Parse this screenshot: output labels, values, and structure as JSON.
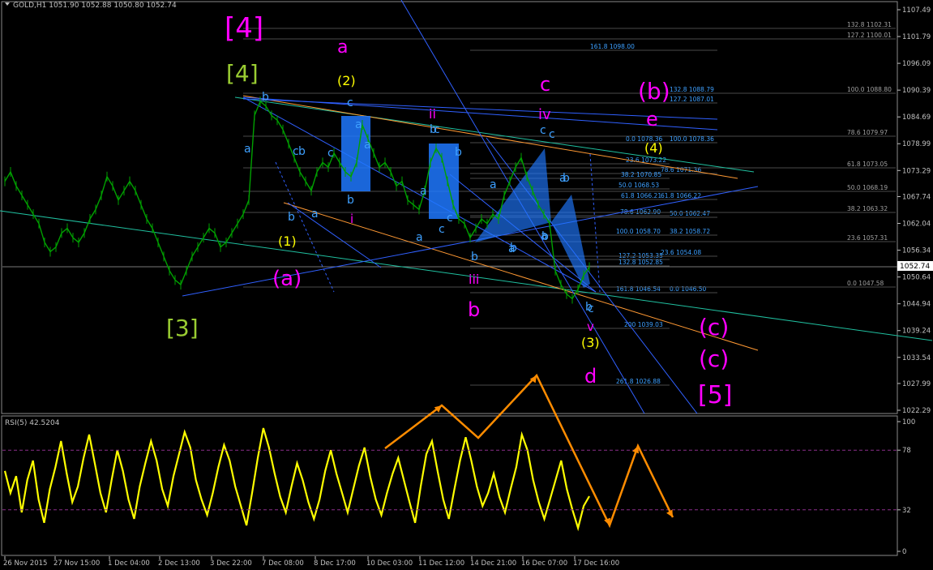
{
  "header": {
    "title": "GOLD,H1  1051.90 1052.88 1050.80 1052.74"
  },
  "rsi_header": {
    "title": "RSI(5) 42.5204"
  },
  "colors": {
    "background": "#000000",
    "candle": "#00a000",
    "rsi": "#ffff00",
    "magenta": "#ff00ff",
    "olive": "#9acd32",
    "blue_label": "#3ea0ff",
    "yellow_label": "#ffff00",
    "orange": "#ff8c00",
    "pattern_fill": "#1e78ff"
  },
  "chart_data": [
    {
      "type": "line",
      "title": "GOLD,H1  1051.90 1052.88 1050.80 1052.74",
      "symbol": "GOLD",
      "timeframe": "H1",
      "ohlc_last": {
        "open": 1051.9,
        "high": 1052.88,
        "low": 1050.8,
        "close": 1052.74
      },
      "ylim": [
        1022.29,
        1107.49
      ],
      "y_ticks": [
        "1107.49",
        "1101.79",
        "1096.09",
        "1090.39",
        "1084.69",
        "1078.99",
        "1073.29",
        "1067.74",
        "1062.04",
        "1056.34",
        "1050.64",
        "1044.94",
        "1039.24",
        "1033.54",
        "1027.99",
        "1022.29"
      ],
      "current_price_label": "1052.74",
      "x_ticks": [
        "26 Nov 2015",
        "27 Nov 15:00",
        "1 Dec 04:00",
        "2 Dec 13:00",
        "3 Dec 22:00",
        "7 Dec 08:00",
        "8 Dec 17:00",
        "10 Dec 03:00",
        "11 Dec 12:00",
        "14 Dec 21:00",
        "16 Dec 07:00",
        "17 Dec 16:00"
      ],
      "series": [
        {
          "values": [
            1071,
            1073,
            1070,
            1068,
            1066,
            1064,
            1062,
            1058,
            1056,
            1057,
            1060,
            1061,
            1059,
            1058,
            1060,
            1063,
            1065,
            1068,
            1072,
            1070,
            1067,
            1069,
            1071,
            1069,
            1066,
            1063,
            1061,
            1058,
            1055,
            1052,
            1050,
            1049,
            1052,
            1055,
            1057,
            1059,
            1061,
            1060,
            1057,
            1058,
            1060,
            1062,
            1064,
            1067,
            1085,
            1088,
            1087,
            1085,
            1084,
            1082,
            1079,
            1076,
            1073,
            1071,
            1069,
            1073,
            1075,
            1074,
            1077,
            1075,
            1073,
            1072,
            1075,
            1083,
            1080,
            1077,
            1074,
            1075,
            1073,
            1070,
            1071,
            1067,
            1066,
            1065,
            1069,
            1075,
            1078,
            1076,
            1071,
            1066,
            1063,
            1062,
            1059,
            1061,
            1063,
            1062,
            1064,
            1063,
            1068,
            1071,
            1074,
            1076,
            1072,
            1069,
            1066,
            1064,
            1062,
            1052,
            1049,
            1047,
            1046,
            1048,
            1051,
            1052.74
          ]
        }
      ],
      "fibonacci_levels": [
        {
          "label": "161.8 1098.00"
        },
        {
          "label": "132.8 1102.31"
        },
        {
          "label": "127.2 1100.01"
        },
        {
          "label": "132.8 1088.79"
        },
        {
          "label": "127.2 1087.01"
        },
        {
          "label": "100.0 1088.80"
        },
        {
          "label": "78.6 1079.97"
        },
        {
          "label": "100.0 1078.36"
        },
        {
          "label": "0.0 1078.36"
        },
        {
          "label": "23.6 1073.22"
        },
        {
          "label": "78.6 1071.36"
        },
        {
          "label": "61.8 1073.05"
        },
        {
          "label": "38.2 1070.85"
        },
        {
          "label": "50.0 1068.53"
        },
        {
          "label": "50.0 1068.19"
        },
        {
          "label": "61.8 1066.21"
        },
        {
          "label": "61.8 1066.22"
        },
        {
          "label": "78.6 1062.90"
        },
        {
          "label": "50.0 1062.47"
        },
        {
          "label": "38.2 1063.32"
        },
        {
          "label": "100.0 1058.70"
        },
        {
          "label": "38.2 1058.72"
        },
        {
          "label": "23.6 1057.31"
        },
        {
          "label": "127.2 1053.35"
        },
        {
          "label": "132.8 1052.85"
        },
        {
          "label": "23.6 1054.08"
        },
        {
          "label": "161.8 1046.54"
        },
        {
          "label": "0.0 1046.50"
        },
        {
          "label": "0.0 1047.58"
        },
        {
          "label": "200 1039.03"
        },
        {
          "label": "261.8 1026.88"
        }
      ]
    },
    {
      "type": "line",
      "title": "RSI(5) 42.5204",
      "indicator": "RSI",
      "period": 5,
      "current_value": 42.5204,
      "ylim": [
        0,
        100
      ],
      "y_ticks": [
        "100",
        "78",
        "32",
        "0"
      ],
      "levels": [
        78,
        32
      ],
      "series": [
        {
          "values": [
            62,
            45,
            58,
            30,
            55,
            70,
            40,
            22,
            48,
            65,
            85,
            60,
            38,
            50,
            72,
            90,
            68,
            45,
            30,
            55,
            78,
            62,
            40,
            25,
            50,
            68,
            85,
            70,
            48,
            35,
            58,
            75,
            92,
            80,
            55,
            40,
            28,
            45,
            65,
            82,
            70,
            50,
            35,
            20,
            45,
            72,
            95,
            80,
            60,
            42,
            30,
            50,
            68,
            55,
            38,
            25,
            40,
            62,
            78,
            60,
            45,
            30,
            48,
            66,
            80,
            58,
            40,
            28,
            45,
            60,
            72,
            55,
            38,
            22,
            50,
            75,
            85,
            62,
            40,
            25,
            48,
            70,
            88,
            70,
            50,
            35,
            45,
            60,
            42,
            30,
            48,
            65,
            90,
            78,
            55,
            38,
            25,
            40,
            55,
            70,
            48,
            32,
            18,
            35,
            42.52
          ]
        }
      ]
    }
  ],
  "wave_labels": {
    "bracket_4_magenta": "[4]",
    "bracket_4_olive": "[4]",
    "bracket_3": "[3]",
    "bracket_5": "[5]",
    "a_mag": "a",
    "b_mag": "b",
    "c_mag": "c",
    "d_mag": "d",
    "e_mag": "e",
    "i_mag": "i",
    "ii_mag": "ii",
    "iii_mag": "iii",
    "iv_mag": "iv",
    "v_mag": "v",
    "pa": "(a)",
    "pb": "(b)",
    "pc1": "(c)",
    "pc2": "(c)",
    "p1": "(1)",
    "p2": "(2)",
    "p3": "(3)",
    "p4": "(4)",
    "small": [
      "b",
      "a",
      "c",
      "b",
      "a",
      "c",
      "a",
      "b",
      "a",
      "c",
      "b",
      "a",
      "c",
      "b",
      "a",
      "b",
      "a",
      "c",
      "b",
      "a",
      "c",
      "b",
      "a",
      "b",
      "c",
      "b",
      "c",
      "a",
      "b",
      "c"
    ]
  }
}
